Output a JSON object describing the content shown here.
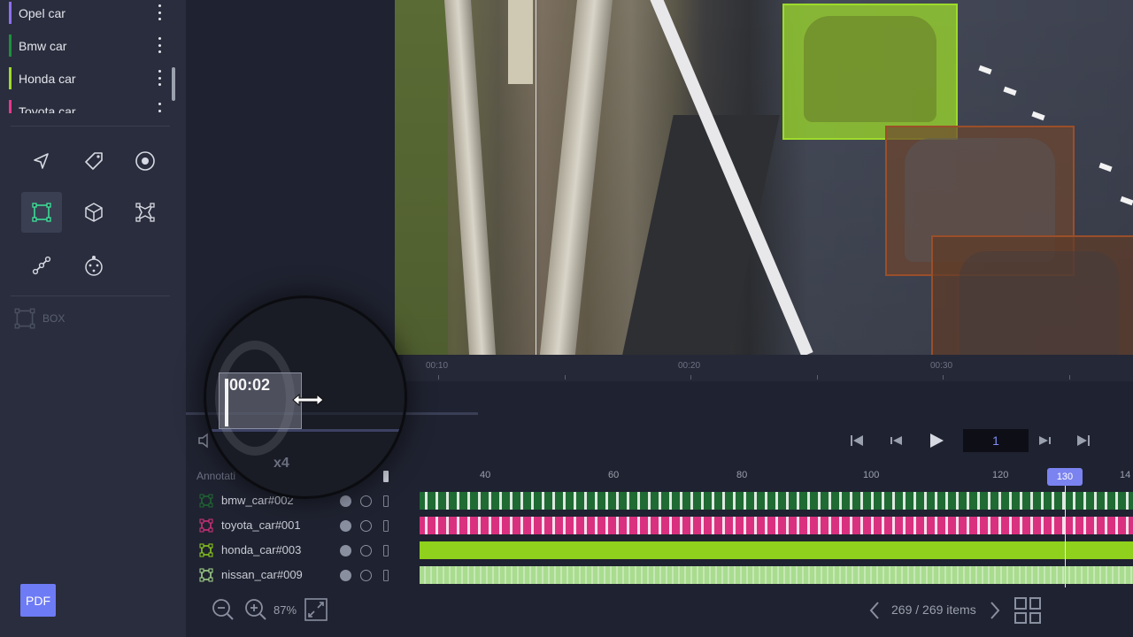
{
  "sidebar": {
    "classes": [
      {
        "label": "Opel car",
        "color": "#8e6ff0"
      },
      {
        "label": "Bmw car",
        "color": "#1f8f3f"
      },
      {
        "label": "Honda car",
        "color": "#9ddb2b"
      },
      {
        "label": "Toyota car",
        "color": "#e8378e"
      }
    ],
    "tools": [
      "polygon-tool",
      "tag-tool",
      "point-tool",
      "box-tool",
      "cuboid-tool",
      "polyline-box-tool",
      "line-tool",
      "skeleton-tool"
    ],
    "selected_tool_label": "BOX",
    "pdf_label": "PDF"
  },
  "ruler": {
    "labels": [
      "00:10",
      "00:20",
      "00:30"
    ]
  },
  "magnifier": {
    "time": "00:02",
    "speed": "x4"
  },
  "playback": {
    "frame_value": "1"
  },
  "annotations": {
    "header": "Annotati",
    "frame_ticks": [
      "40",
      "60",
      "80",
      "100",
      "120",
      "14"
    ],
    "current_frame": "130",
    "tracks": [
      {
        "name": "bmw_car#002",
        "color": "#1f6b33"
      },
      {
        "name": "toyota_car#001",
        "color": "#d9317f"
      },
      {
        "name": "honda_car#003",
        "color": "#8fd11d"
      },
      {
        "name": "nissan_car#009",
        "color": "#a9dc8f"
      }
    ]
  },
  "zoom": {
    "percent": "87%"
  },
  "pagination": {
    "items_text": "269 / 269 items"
  },
  "colors": {
    "accent": "#6d7bf5",
    "honda_box": "#9ddb2b",
    "brown_box": "#9a4f2a"
  }
}
